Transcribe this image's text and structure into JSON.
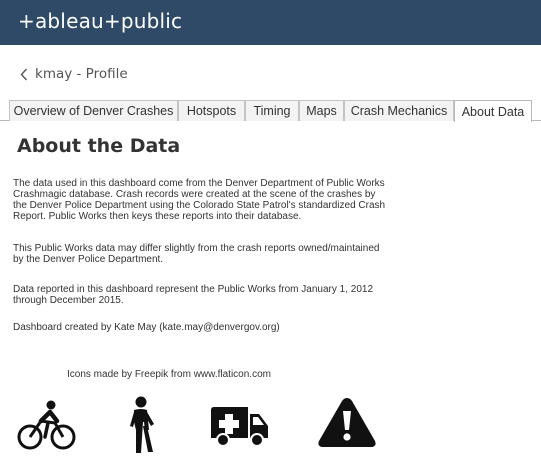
{
  "header": {
    "logo_text": "+ableau+public"
  },
  "nav": {
    "back_label": "kmay - Profile"
  },
  "tabs": [
    {
      "label": "Overview of Denver Crashes",
      "active": false
    },
    {
      "label": "Hotspots",
      "active": false
    },
    {
      "label": "Timing",
      "active": false
    },
    {
      "label": "Maps",
      "active": false
    },
    {
      "label": "Crash Mechanics",
      "active": false
    },
    {
      "label": "About Data",
      "active": true
    }
  ],
  "content": {
    "title": "About the Data",
    "para1": [
      "The data used in this dashboard come from the Denver Department of Public Works",
      "Crashmagic database. Crash records were created at the scene of the crashes by",
      "the Denver Police Department  using the Colorado State Patrol's standardized Crash",
      "Report. Public Works then keys these reports into their database."
    ],
    "para2": [
      "This Public Works data may differ slightly from the crash reports owned/maintained",
      "by the Denver Police Department."
    ],
    "para3": [
      "Data reported in this dashboard represent the Public Works from January 1, 2012",
      "through December 2015."
    ],
    "para4": [
      "Dashboard created by Kate May (kate.may@denvergov.org)"
    ],
    "credit": "Icons made by Freepik from www.flaticon.com"
  },
  "icons": [
    "bicycle-icon",
    "pedestrian-icon",
    "ambulance-icon",
    "warning-icon"
  ],
  "colors": {
    "header_bg": "#2e4a66",
    "text": "#333333",
    "icon": "#111111"
  }
}
